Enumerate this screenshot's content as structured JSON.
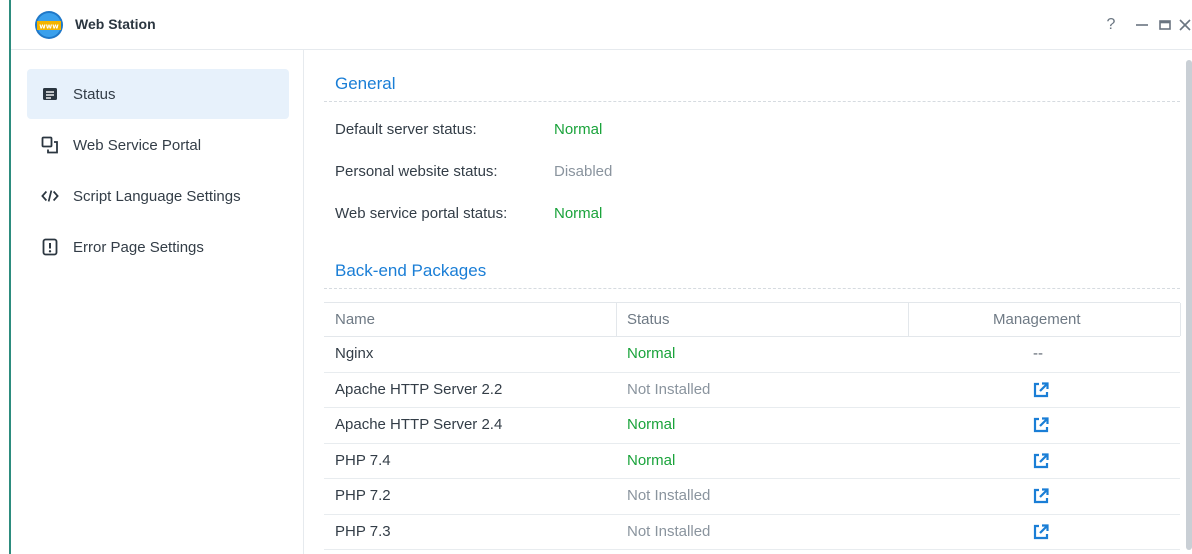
{
  "window": {
    "title": "Web Station",
    "controls": {
      "help": "?",
      "minimize": "—",
      "maximize": "□",
      "close": "✕"
    }
  },
  "sidebar": {
    "items": [
      {
        "label": "Status",
        "icon": "status-list-icon",
        "active": true
      },
      {
        "label": "Web Service Portal",
        "icon": "portal-icon",
        "active": false
      },
      {
        "label": "Script Language Settings",
        "icon": "code-icon",
        "active": false
      },
      {
        "label": "Error Page Settings",
        "icon": "error-page-icon",
        "active": false
      }
    ]
  },
  "general": {
    "title": "General",
    "rows": [
      {
        "label": "Default server status:",
        "value": "Normal",
        "state": "green"
      },
      {
        "label": "Personal website status:",
        "value": "Disabled",
        "state": "grey"
      },
      {
        "label": "Web service portal status:",
        "value": "Normal",
        "state": "green"
      }
    ]
  },
  "backend": {
    "title": "Back-end Packages",
    "columns": {
      "name": "Name",
      "status": "Status",
      "management": "Management"
    },
    "rows": [
      {
        "name": "Nginx",
        "status": "Normal",
        "state": "green",
        "management": "--"
      },
      {
        "name": "Apache HTTP Server 2.2",
        "status": "Not Installed",
        "state": "grey",
        "management": "external-link-icon"
      },
      {
        "name": "Apache HTTP Server 2.4",
        "status": "Normal",
        "state": "green",
        "management": "external-link-icon"
      },
      {
        "name": "PHP 7.4",
        "status": "Normal",
        "state": "green",
        "management": "external-link-icon"
      },
      {
        "name": "PHP 7.2",
        "status": "Not Installed",
        "state": "grey",
        "management": "external-link-icon"
      },
      {
        "name": "PHP 7.3",
        "status": "Not Installed",
        "state": "grey",
        "management": "external-link-icon"
      }
    ]
  },
  "colors": {
    "accent": "#1a7ed6",
    "normal": "#1aa33b",
    "disabled": "#8a949e",
    "active_nav": "#e7f1fb"
  }
}
